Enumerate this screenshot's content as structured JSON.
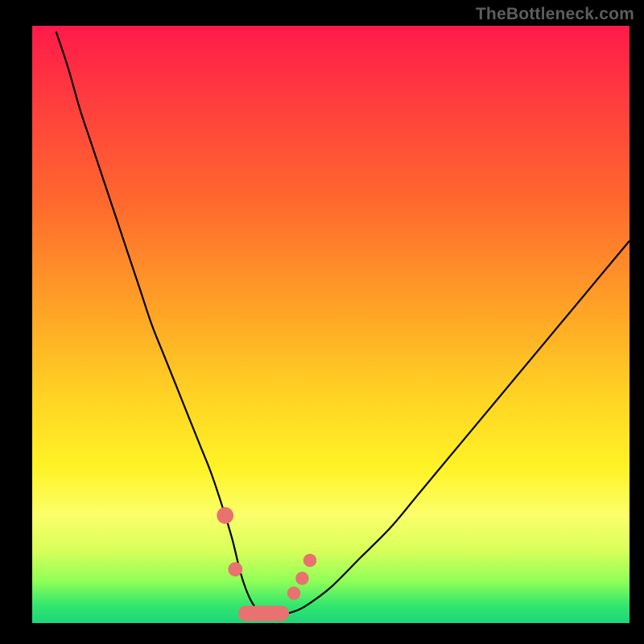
{
  "watermark": {
    "text": "TheBottleneck.com"
  },
  "chart_data": {
    "type": "line",
    "title": "",
    "xlabel": "",
    "ylabel": "",
    "xlim": [
      0,
      100
    ],
    "ylim": [
      0,
      100
    ],
    "grid": false,
    "series": [
      {
        "name": "bottleneck-curve",
        "x": [
          4,
          6,
          8,
          10,
          12,
          14,
          16,
          18,
          20,
          22,
          24,
          26,
          28,
          30,
          32,
          33.5,
          35,
          36.5,
          38,
          40,
          42,
          44,
          46,
          50,
          55,
          60,
          65,
          70,
          75,
          80,
          85,
          90,
          95,
          100
        ],
        "values": [
          99,
          93,
          86,
          80,
          74,
          68,
          62,
          56,
          50,
          45,
          40,
          35,
          30,
          25,
          19,
          14,
          8,
          4,
          2,
          1.5,
          1.5,
          2,
          3,
          6,
          11,
          16,
          22,
          28,
          34,
          40,
          46,
          52,
          58,
          64
        ]
      }
    ],
    "dot_markers": {
      "name": "highlight-dots",
      "x": [
        32.3,
        34.0,
        43.8,
        45.2,
        46.5
      ],
      "y": [
        18.0,
        9.0,
        5.0,
        7.5,
        10.5
      ],
      "r": [
        1.4,
        1.2,
        1.1,
        1.1,
        1.1
      ]
    },
    "bottom_bar": {
      "name": "bottom-band",
      "x_start": 34.5,
      "x_end": 43.0,
      "y_center": 1.6,
      "height": 2.6
    },
    "gradient_stops": [
      {
        "pos": 0,
        "color": "#ff1a4a"
      },
      {
        "pos": 30,
        "color": "#ff6a2d"
      },
      {
        "pos": 62,
        "color": "#ffd324"
      },
      {
        "pos": 82,
        "color": "#fbff6a"
      },
      {
        "pos": 100,
        "color": "#1bd77a"
      }
    ]
  }
}
